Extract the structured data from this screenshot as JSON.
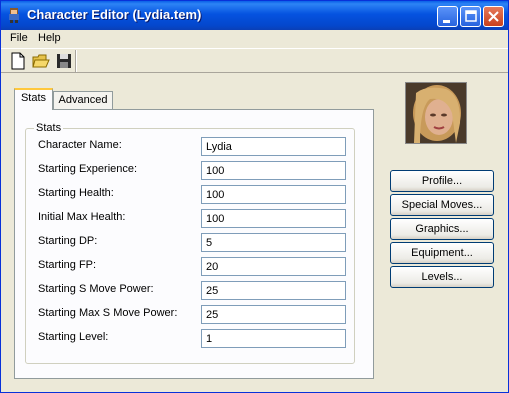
{
  "window": {
    "title": "Character Editor  (Lydia.tem)"
  },
  "menu": [
    "File",
    "Help"
  ],
  "toolbar": {
    "new": "new-file-icon",
    "open": "open-folder-icon",
    "save": "save-disk-icon"
  },
  "tabs": [
    "Stats",
    "Advanced"
  ],
  "stats": {
    "group_label": "Stats",
    "rows": [
      {
        "label": "Character Name:",
        "value": "Lydia"
      },
      {
        "label": "Starting Experience:",
        "value": "100"
      },
      {
        "label": "Starting Health:",
        "value": "100"
      },
      {
        "label": "Initial Max Health:",
        "value": "100"
      },
      {
        "label": "Starting DP:",
        "value": "5"
      },
      {
        "label": "Starting FP:",
        "value": "20"
      },
      {
        "label": "Starting S Move Power:",
        "value": "25"
      },
      {
        "label": "Starting Max S Move Power:",
        "value": "25"
      },
      {
        "label": "Starting Level:",
        "value": "1"
      }
    ]
  },
  "side_buttons": [
    "Profile...",
    "Special Moves...",
    "Graphics...",
    "Equipment...",
    "Levels..."
  ],
  "colors": {
    "titlebar": "#0553e0",
    "window_bg": "#ece9d8",
    "close": "#c8401c"
  }
}
